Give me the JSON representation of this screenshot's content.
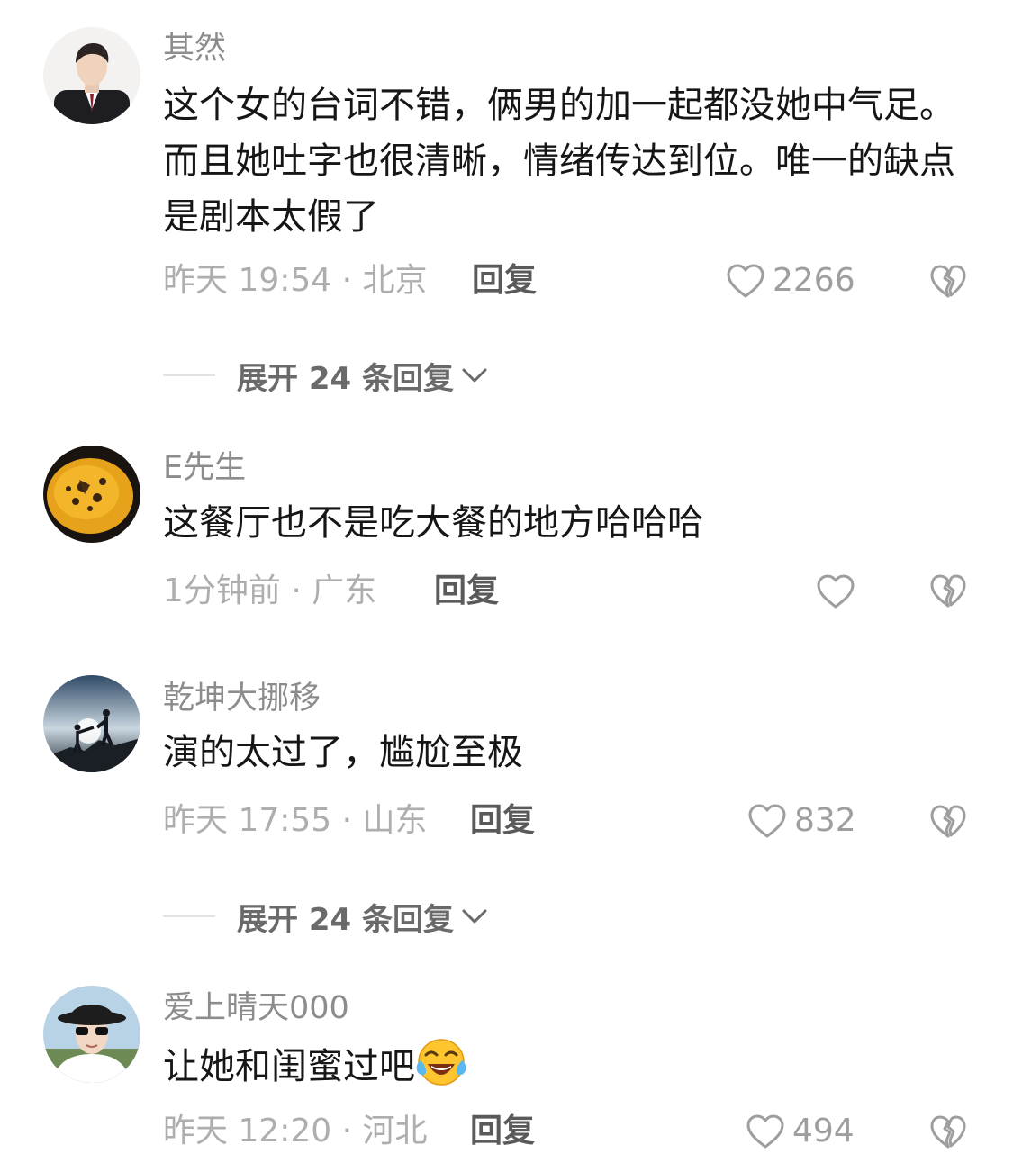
{
  "comments": [
    {
      "username": "其然",
      "text": "这个女的台词不错，俩男的加一起都没她中气足。而且她吐字也很清晰，情绪传达到位。唯一的缺点是剧本太假了",
      "time_location": "昨天 19:54 · 北京",
      "reply_label": "回复",
      "like_count": "2266",
      "expand_replies": "展开 24 条回复",
      "avatar_icon": "man-in-suit-avatar"
    },
    {
      "username": "E先生",
      "text": "这餐厅也不是吃大餐的地方哈哈哈",
      "time_location": "1分钟前 · 广东",
      "reply_label": "回复",
      "like_count": "",
      "avatar_icon": "golden-stone-avatar"
    },
    {
      "username": "乾坤大挪移",
      "text": "演的太过了，尴尬至极",
      "time_location": "昨天 17:55 · 山东",
      "reply_label": "回复",
      "like_count": "832",
      "expand_replies": "展开 24 条回复",
      "avatar_icon": "climbers-silhouette-avatar"
    },
    {
      "username": "爱上晴天000",
      "text": "让她和闺蜜过吧",
      "time_location": "昨天 12:20 · 河北",
      "reply_label": "回复",
      "like_count": "494",
      "avatar_icon": "woman-with-hat-avatar",
      "emoji": "laughing-crying-emoji"
    }
  ],
  "colors": {
    "username": "#8c8c8c",
    "meta": "#aeaeae",
    "text": "#161616",
    "icon": "#9e9e9e"
  }
}
